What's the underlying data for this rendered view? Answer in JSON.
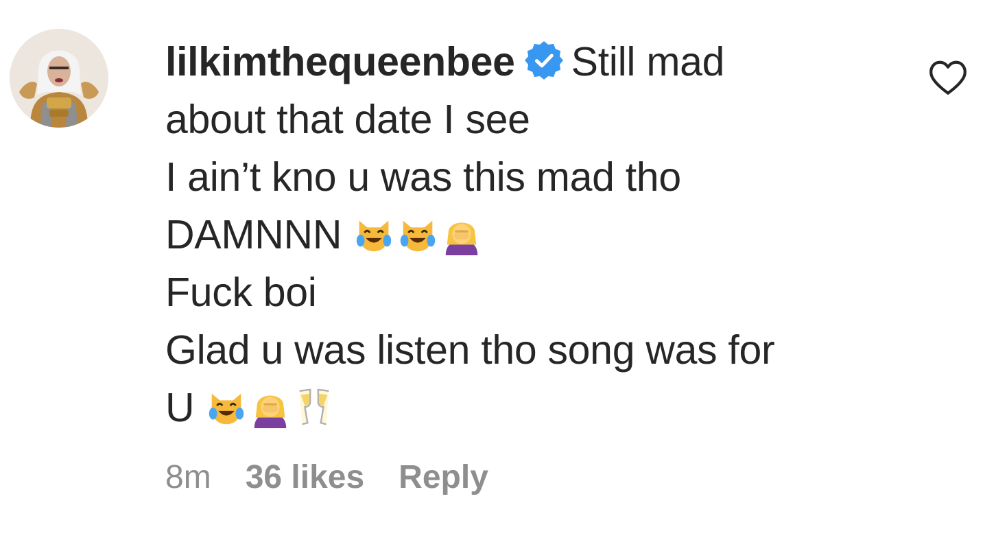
{
  "comment": {
    "username": "lilkimthequeenbee",
    "verified_icon": "verified-badge-icon",
    "first_line": "Still mad",
    "lines": [
      "about that date I see",
      "I ain’t kno u was this mad tho",
      "DAMNNN",
      "Fuck boi",
      "Glad u was listen tho song was for",
      "U"
    ],
    "emoji_line4": [
      "cat-tears-of-joy-emoji",
      "cat-tears-of-joy-emoji",
      "woman-facepalming-emoji"
    ],
    "emoji_line7": [
      "cat-tears-of-joy-emoji",
      "woman-facepalming-emoji",
      "clinking-glasses-emoji"
    ]
  },
  "meta": {
    "time": "8m",
    "likes": "36 likes",
    "reply": "Reply"
  },
  "like_icon": "heart-outline-icon",
  "colors": {
    "text": "#262626",
    "secondary": "#8e8e8e",
    "verified": "#3897f0"
  }
}
